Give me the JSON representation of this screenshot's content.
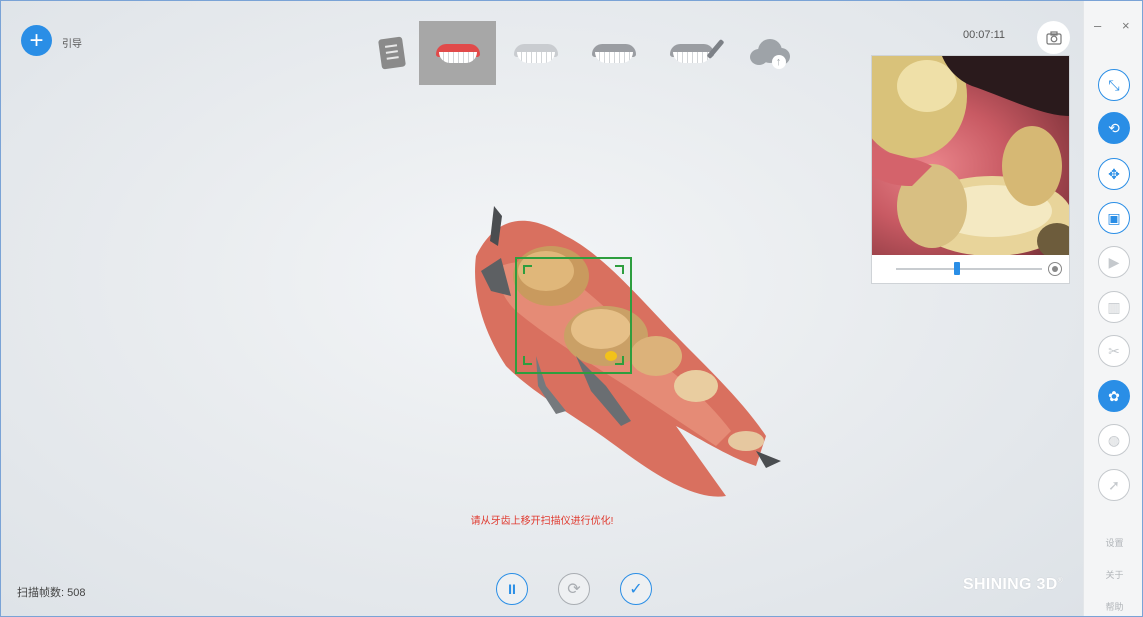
{
  "header": {
    "guide_label": "引导",
    "steps": [
      {
        "name": "order",
        "icon": "order-form-icon"
      },
      {
        "name": "upper-jaw",
        "icon": "upper-jaw-icon"
      },
      {
        "name": "lower-jaw",
        "icon": "lower-jaw-icon"
      },
      {
        "name": "bite",
        "icon": "bite-icon"
      },
      {
        "name": "edit",
        "icon": "edit-jaw-icon"
      },
      {
        "name": "upload",
        "icon": "cloud-upload-icon"
      }
    ],
    "active_step": 1
  },
  "timer": "00:07:11",
  "preview": {
    "slider_value": 0.4
  },
  "scan": {
    "warning": "请从牙齿上移开扫描仪进行优化!"
  },
  "status": {
    "frame_count_label": "扫描帧数:",
    "frame_count": "508"
  },
  "brand": {
    "name": "SHINING 3D",
    "mark": "®"
  },
  "sidebar": {
    "window_min": "–",
    "window_close": "×",
    "tools": [
      {
        "name": "fit-view",
        "icon": "fit-view-icon",
        "state": "normal"
      },
      {
        "name": "rotate",
        "icon": "rotate-icon",
        "state": "active"
      },
      {
        "name": "pan",
        "icon": "pan-icon",
        "state": "normal"
      },
      {
        "name": "lock",
        "icon": "lock-icon",
        "state": "normal"
      },
      {
        "name": "play",
        "icon": "play-icon",
        "state": "disabled"
      },
      {
        "name": "delete",
        "icon": "trash-icon",
        "state": "disabled"
      },
      {
        "name": "cut",
        "icon": "cut-icon",
        "state": "disabled"
      },
      {
        "name": "texture",
        "icon": "texture-icon",
        "state": "active"
      },
      {
        "name": "occlusion",
        "icon": "occlusion-icon",
        "state": "disabled"
      },
      {
        "name": "select",
        "icon": "select-icon",
        "state": "disabled"
      }
    ],
    "settings_label": "设置",
    "about_label": "关于",
    "help_label": "帮助"
  },
  "colors": {
    "accent": "#2a8ee6",
    "warning": "#e03a2f",
    "focus_frame": "#2e9e3e"
  }
}
